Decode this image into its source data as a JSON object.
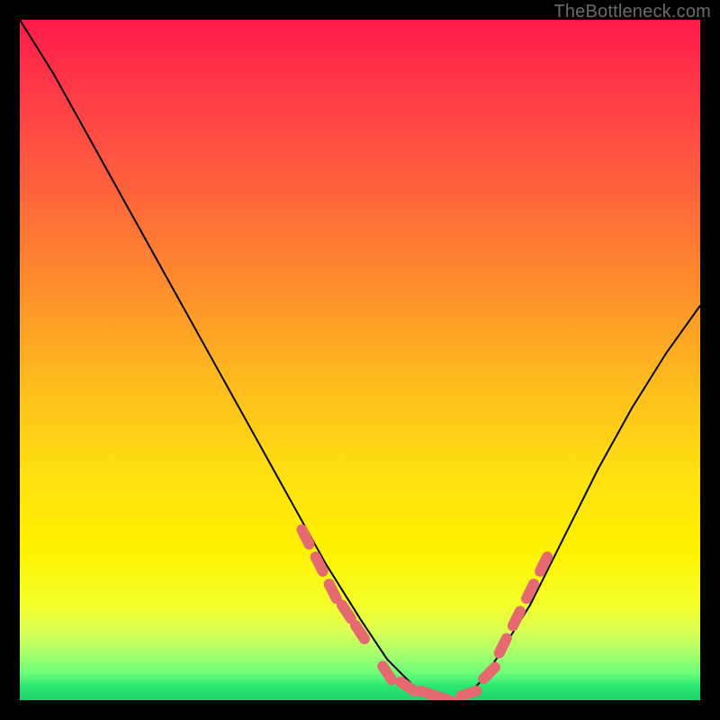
{
  "watermark": "TheBottleneck.com",
  "colors": {
    "curve_stroke": "#000000",
    "marker_fill": "#e46a6f",
    "background_frame": "#000000"
  },
  "chart_data": {
    "type": "line",
    "title": "",
    "xlabel": "",
    "ylabel": "",
    "xlim": [
      0,
      100
    ],
    "ylim": [
      0,
      100
    ],
    "series": [
      {
        "name": "bottleneck-curve",
        "x": [
          0,
          5,
          10,
          15,
          20,
          25,
          30,
          35,
          40,
          45,
          50,
          52,
          54,
          56,
          58,
          60,
          62,
          64,
          66,
          68,
          70,
          75,
          80,
          85,
          90,
          95,
          100
        ],
        "y": [
          100,
          92,
          83,
          74,
          65,
          56,
          47,
          38,
          29,
          20,
          12,
          9,
          6,
          4,
          2,
          1,
          0,
          0,
          1,
          3,
          6,
          14,
          24,
          34,
          43,
          51,
          58
        ]
      }
    ],
    "markers": {
      "name": "highlight-dots",
      "x": [
        42,
        44,
        46,
        48,
        50,
        54,
        57,
        60,
        63,
        66,
        69,
        71,
        73,
        75,
        77
      ],
      "y": [
        24,
        20,
        16,
        13,
        10,
        4,
        2,
        1,
        0,
        1,
        4,
        8,
        12,
        16,
        20
      ]
    }
  }
}
